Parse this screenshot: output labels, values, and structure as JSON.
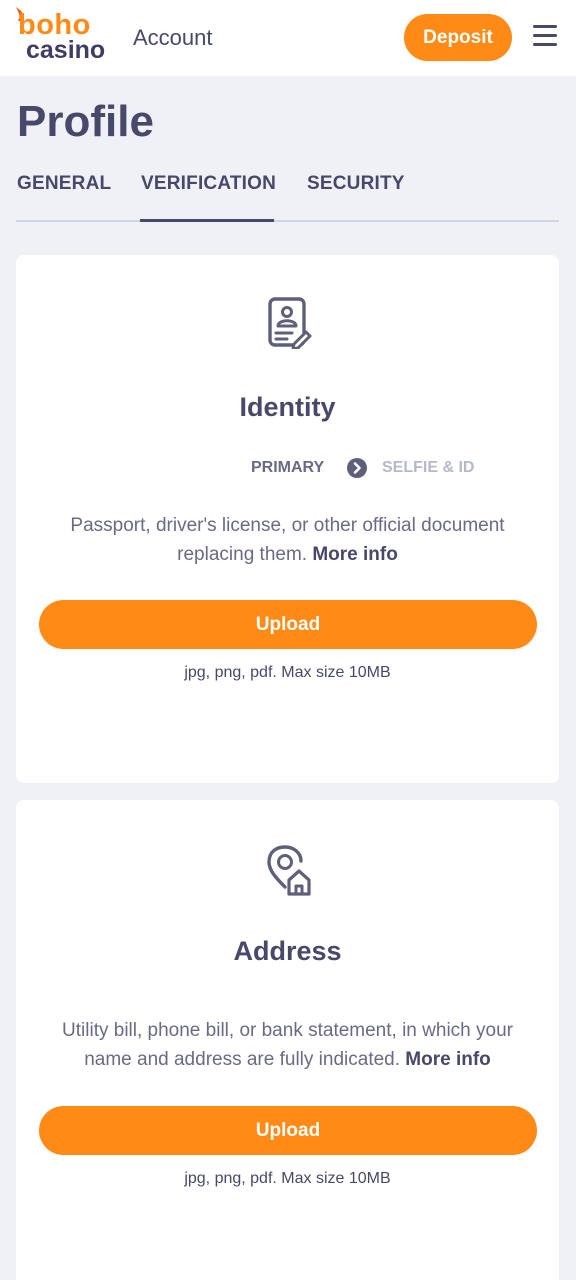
{
  "header": {
    "logo_top": "boho",
    "logo_bottom": "casino",
    "title": "Account",
    "deposit_label": "Deposit"
  },
  "page": {
    "title": "Profile"
  },
  "tabs": [
    {
      "label": "GENERAL",
      "active": false
    },
    {
      "label": "VERIFICATION",
      "active": true
    },
    {
      "label": "SECURITY",
      "active": false
    }
  ],
  "identity": {
    "title": "Identity",
    "step_primary": "PRIMARY",
    "step_secondary": "SELFIE & ID",
    "description": "Passport, driver's license, or other official document replacing them.",
    "more_info": "More info",
    "upload_label": "Upload",
    "file_hint": "jpg, png, pdf. Max size 10MB",
    "icon": "id-card-icon"
  },
  "address": {
    "title": "Address",
    "description": "Utility bill, phone bill, or bank statement, in which your name and address are fully indicated.",
    "more_info": "More info",
    "upload_label": "Upload",
    "file_hint": "jpg, png, pdf. Max size 10MB",
    "icon": "location-home-icon"
  },
  "colors": {
    "accent": "#ff8a15",
    "text": "#48486a",
    "muted": "#6a6a86",
    "background": "#eff1f6"
  }
}
